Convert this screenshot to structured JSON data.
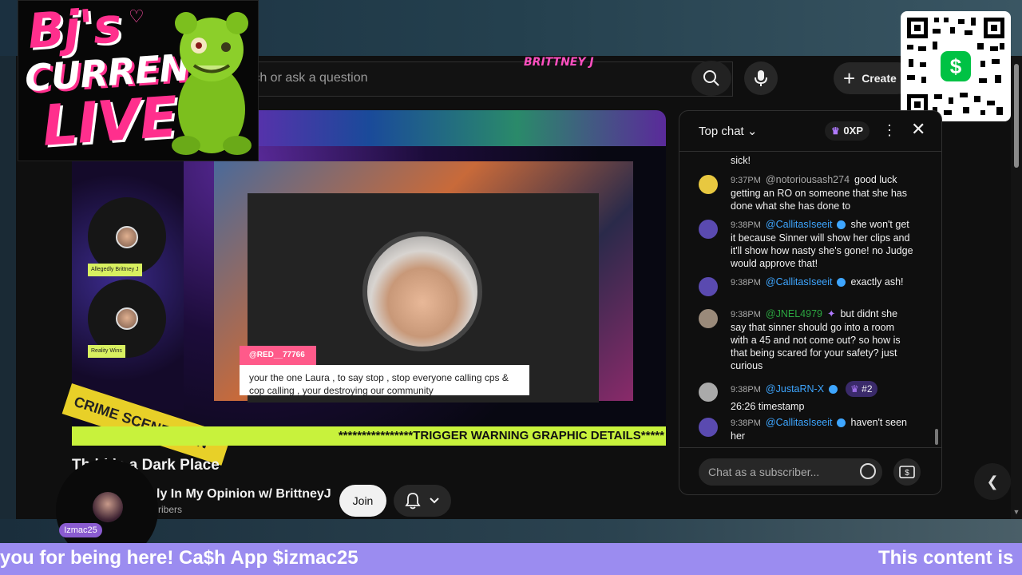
{
  "overlay": {
    "logo_line1": "Bj's",
    "logo_line2": "CURRENT",
    "logo_line3": "LIVE",
    "qr_icon": "cash-app-dollar-icon",
    "qr_symbol": "$"
  },
  "header": {
    "search_placeholder": "rch or ask a question",
    "create_label": "Create"
  },
  "video": {
    "streamer_label": "BRITTNEY J",
    "left_tag_1": "Allegedly Brittney J",
    "left_tag_2": "Reality Wins",
    "crime_tape": "CRIME SCENE DO N",
    "comment_user": "@RED__77766",
    "comment_text": "your the one Laura , to say stop , stop everyone calling cps & cop calling , your destroying our community",
    "trigger_banner": "****************TRIGGER WARNING GRAPHIC DETAILS*****"
  },
  "meta": {
    "title": "Th    ld is a Dark Place",
    "channel": "ly In My Opinion w/ BrittneyJ",
    "subscribers": "scribers",
    "join_label": "Join"
  },
  "viewer": {
    "name": "Izmac25"
  },
  "chat": {
    "header_label": "Top chat",
    "xp_label": "0XP",
    "placeholder": "Chat as a subscriber...",
    "partial_top": "sick!",
    "messages": [
      {
        "time": "9:37PM",
        "author": "@notoriousash274",
        "text": "good luck getting an RO on someone that she has done what she has done to"
      },
      {
        "time": "9:38PM",
        "author": "@CallitasIseeit",
        "text": "she won't get it because Sinner will show her clips and it'll show how nasty she's gone! no Judge would approve that!"
      },
      {
        "time": "9:38PM",
        "author": "@CallitasIseeit",
        "text": "exactly ash!"
      },
      {
        "time": "9:38PM",
        "author": "@JNEL4979",
        "text": "but didnt she say that sinner should go into a room with a 45 and not come out? so how is that being scared for your safety? just curious"
      },
      {
        "time": "9:38PM",
        "author": "@JustaRN-X",
        "rank": "#2",
        "text": "26:26 timestamp"
      },
      {
        "time": "9:38PM",
        "author": "@CallitasIseeit",
        "text": "haven't seen her"
      }
    ]
  },
  "ticker": {
    "left": "you for being here! Ca$h App $izmac25",
    "right": "This content is"
  },
  "colors": {
    "ticker_bg": "#9b8cf0",
    "trigger_bg": "#c8f23c",
    "link_blue": "#3ea6ff",
    "logo_pink": "#ff2f8d"
  }
}
